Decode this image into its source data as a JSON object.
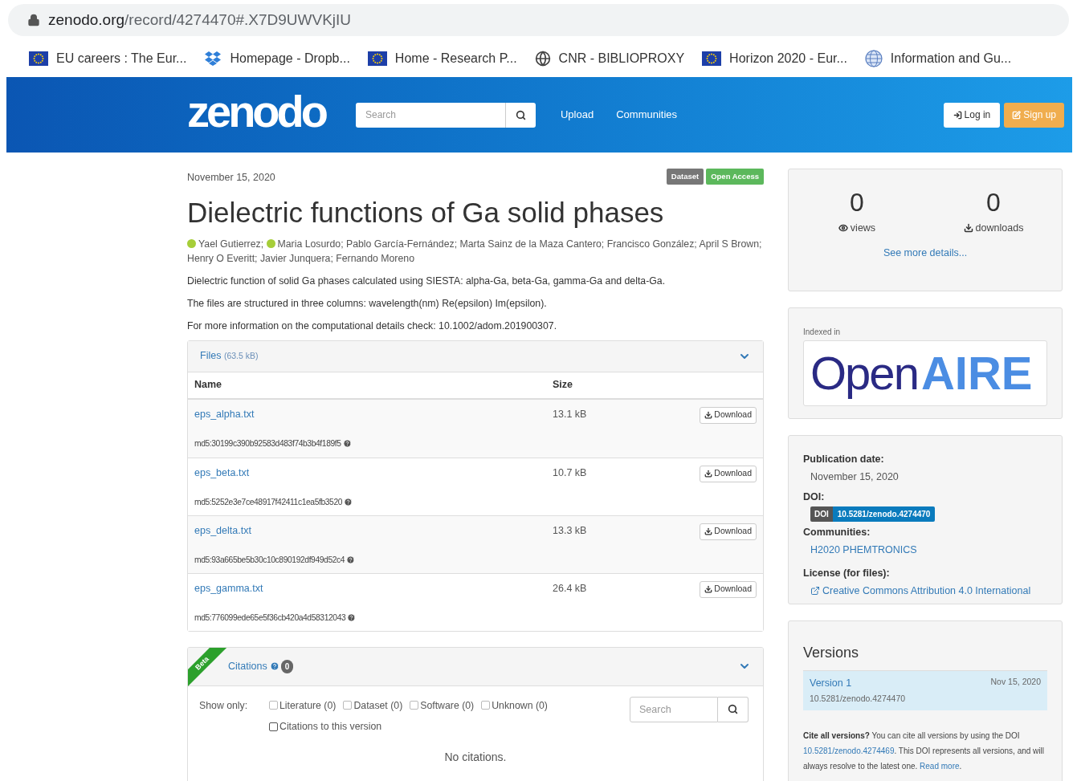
{
  "browser": {
    "url_host": "zenodo.org",
    "url_path": "/record/4274470#.X7D9UWVKjIU",
    "bookmarks": [
      {
        "kind": "eu-flag",
        "label": "EU careers : The Eur..."
      },
      {
        "kind": "dropbox",
        "label": "Homepage - Dropb..."
      },
      {
        "kind": "eu-flag",
        "label": "Home - Research P..."
      },
      {
        "kind": "globe",
        "label": "CNR - BIBLIOPROXY"
      },
      {
        "kind": "eu-flag",
        "label": "Horizon 2020 - Eur..."
      },
      {
        "kind": "web-globe",
        "label": "Information and Gu..."
      }
    ]
  },
  "navbar": {
    "logo": "zenodo",
    "search_placeholder": "Search",
    "links": [
      "Upload",
      "Communities"
    ],
    "login": "Log in",
    "signup": "Sign up"
  },
  "record": {
    "date": "November 15, 2020",
    "badges": [
      {
        "label": "Dataset",
        "color": "#777777"
      },
      {
        "label": "Open Access",
        "color": "#5cb85c"
      }
    ],
    "title": "Dielectric functions of Ga solid phases",
    "authors": [
      {
        "name": "Yael Gutierrez;",
        "orcid": true
      },
      {
        "name": "Maria Losurdo;",
        "orcid": true
      },
      {
        "name": "Pablo García-Fernández;",
        "orcid": false
      },
      {
        "name": "Marta Sainz de la Maza Cantero;",
        "orcid": false
      },
      {
        "name": "Francisco González;",
        "orcid": false
      },
      {
        "name": "April S Brown;",
        "orcid": false
      },
      {
        "name": "Henry O Everitt;",
        "orcid": false
      },
      {
        "name": "Javier Junquera;",
        "orcid": false
      },
      {
        "name": "Fernando Moreno",
        "orcid": false
      }
    ],
    "paragraphs": [
      "Dielectric function of solid Ga phases calculated using SIESTA: alpha-Ga, beta-Ga, gamma-Ga and delta-Ga.",
      "The files are structured in three columns: wavelength(nm) Re(epsilon) Im(epsilon).",
      "For more information on the computational details check: 10.1002/adom.201900307."
    ]
  },
  "files": {
    "title": "Files",
    "size": "(63.5 kB)",
    "columns": [
      "Name",
      "Size"
    ],
    "rows": [
      {
        "name": "eps_alpha.txt",
        "size": "13.1 kB",
        "button": "Download",
        "md5": "md5:30199c390b92583d483f74b3b4f189f5"
      },
      {
        "name": "eps_beta.txt",
        "size": "10.7 kB",
        "button": "Download",
        "md5": "md5:5252e3e7ce48917f42411c1ea5fb3520"
      },
      {
        "name": "eps_delta.txt",
        "size": "13.3 kB",
        "button": "Download",
        "md5": "md5:93a665be5b30c10c890192df949d52c4"
      },
      {
        "name": "eps_gamma.txt",
        "size": "26.4 kB",
        "button": "Download",
        "md5": "md5:776099ede65e5f36cb420a4d58312043"
      }
    ]
  },
  "citations": {
    "ribbon": "Beta",
    "title": "Citations",
    "count": "0",
    "show_only": "Show only:",
    "filters": [
      {
        "label": "Literature (0)",
        "checked": false
      },
      {
        "label": "Dataset (0)",
        "checked": false
      },
      {
        "label": "Software (0)",
        "checked": false
      },
      {
        "label": "Unknown (0)",
        "checked": false
      }
    ],
    "version_filter": {
      "label": "Citations to this version",
      "checked": false
    },
    "search_placeholder": "Search",
    "empty": "No citations."
  },
  "sidebar": {
    "stats": [
      {
        "kind": "views",
        "value": "0",
        "label": "views"
      },
      {
        "kind": "downloads",
        "value": "0",
        "label": "downloads"
      }
    ],
    "more": "See more details...",
    "indexed_label": "Indexed in",
    "openaire": {
      "part_1": "Open",
      "part_2": "AIRE"
    },
    "details": {
      "pub_label": "Publication date:",
      "pub_value": "November 15, 2020",
      "doi_label": "DOI:",
      "doi_badge": "DOI",
      "doi_value": "10.5281/zenodo.4274470",
      "communities_label": "Communities:",
      "community": "H2020 PHEMTRONICS",
      "license_label": "License (for files):",
      "license": "Creative Commons Attribution 4.0 International"
    },
    "versions": {
      "title": "Versions",
      "items": [
        {
          "label": "Version 1",
          "date": "Nov 15, 2020",
          "doi": "10.5281/zenodo.4274470",
          "selected": true
        }
      ],
      "cite": {
        "lead": "Cite all versions?",
        "text_1": " You can cite all versions by using the DOI ",
        "doi_link": "10.5281/zenodo.4274469",
        "text_2": ". This DOI represents all versions, and will always resolve to the latest one. ",
        "read_more": "Read more",
        "end": "."
      }
    }
  }
}
